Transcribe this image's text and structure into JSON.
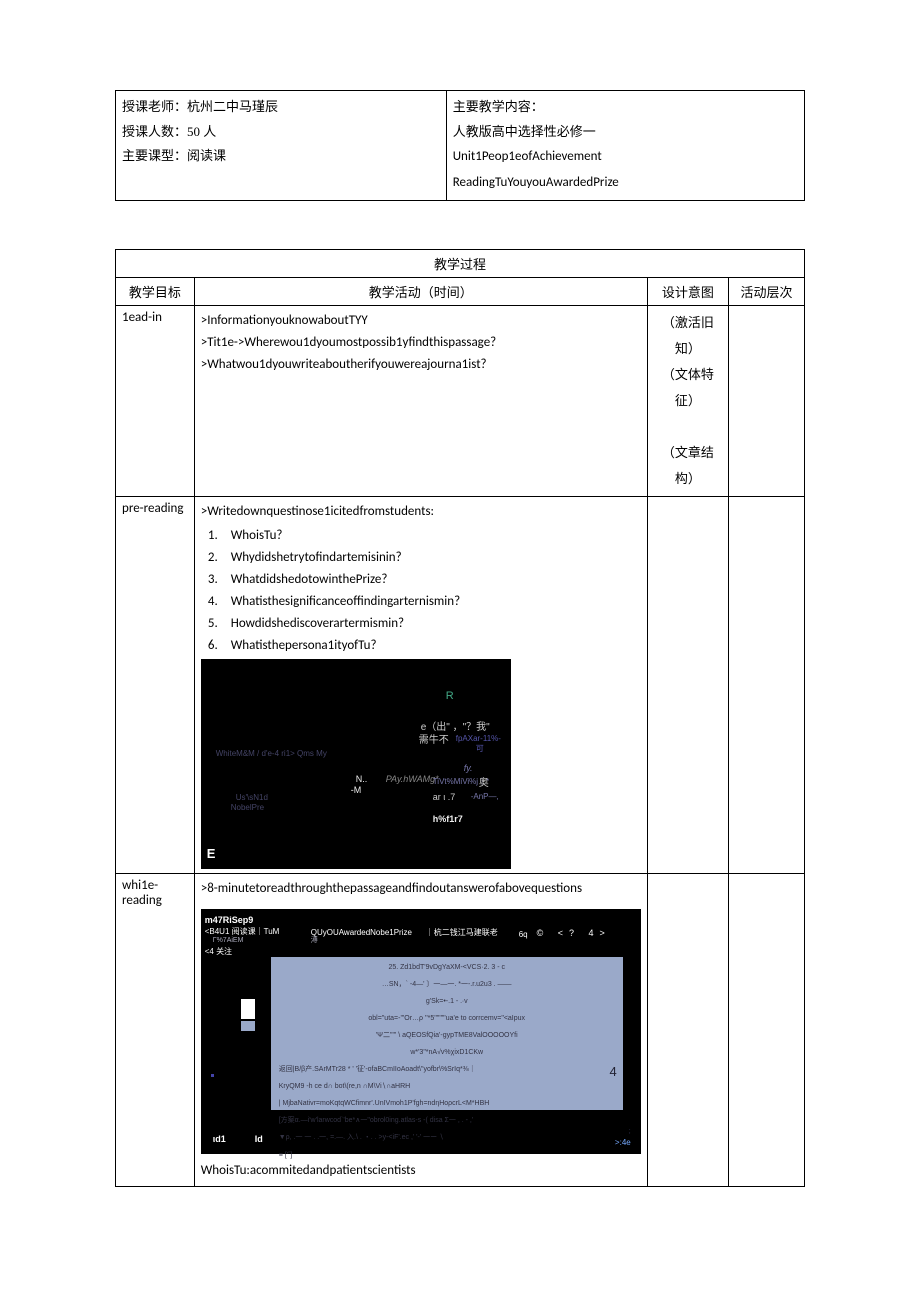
{
  "header": {
    "teacher_label": "授课老师：",
    "teacher_value": "杭州二中马瑾辰",
    "count_label": "授课人数：",
    "count_value": "50 人",
    "type_label": "主要课型：",
    "type_value": "阅读课",
    "content_label": "主要教学内容：",
    "content_line1": "人教版高中选择性必修一",
    "content_line2": "Unit1Peop1eofAchievement",
    "content_line3": "ReadingTuYouyouAwardedPrize"
  },
  "main": {
    "title": "教学过程",
    "cols": {
      "c1": "教学目标",
      "c2": "教学活动（时间）",
      "c3": "设计意图",
      "c4": "活动层次"
    },
    "rows": [
      {
        "stage": "1ead-in",
        "activity": {
          "l1": ">InformationyouknowaboutTYY",
          "l2": ">Tit1e->Wherewou1dyoumostpossib1yfindthispassage?",
          "l3": ">Whatwou1dyouwriteaboutherifyouwereajourna1ist?"
        },
        "design": {
          "d1": "（激活旧知）",
          "d2": "（文体特征）",
          "d3": "（文章结构）"
        }
      },
      {
        "stage": "pre-reading",
        "activity": {
          "intro": ">Writedownquestinose1icitedfromstudents:",
          "q": [
            "WhoisTu?",
            "Whydidshetrytofindartemisinin?",
            "WhatdidshedotowinthePrize?",
            "Whatisthesignificanceoffindingarternismin?",
            "Howdidshediscoverartermismin?",
            "Whatisthepersona1ityofTu?"
          ]
        },
        "img": {
          "r": "R",
          "chu": "e（出\" ，\"？我\"",
          "xu": "需牛不",
          "fp": "fpAXar-11%-",
          "ke": "可",
          "blue1": "WhiteM&M / d'e-4 ri1> Qms My",
          "n": "N..",
          "m": "-M",
          "pay": "PAy.hWAMg*",
          "fy": "fy.",
          "tw": "TiVt%MiVi%j｜*",
          "ao": "奥",
          "ar": "ar ι .7",
          "anp": "-AnP—,",
          "us": "Us'\\sN1d",
          "np": "NobelPre",
          "hf": "h%f1r7",
          "e": "E"
        }
      },
      {
        "stage": "whi1e-reading",
        "activity": {
          "l1": ">8-minutetoreadthroughthepassageandfindoutanswerofabovequestions",
          "tail": "WhoisTu:acommitedandpatientscientists"
        },
        "img": {
          "top1": "m47RiSep9",
          "top2": "<B4U1 阅读课｜TuM",
          "top3": "Γ%7AiEM",
          "top4": "<4 关注",
          "qy": "QUyOUAwardedNobe1Prize",
          "hz": "｜杭二钱江马建联老",
          "hang": "溥",
          "six": "6q",
          "ico": "©   <?    4>",
          "p1": "25.  Zd1bdT'9vDgYaXM-<VCS·2.   3 - c",
          "p2": "…SN，`  -4—' 〕一—一.  *一-.r.u2u3   . ——",
          "p3": "g'Sk=•-.1 - .∙v",
          "p4": "obl=\"uta=-'\"Or…ρ ''*5'\"\"'\"'ua'e to corrcemv=\"<aIpux",
          "p5": "'Ψ二'\"\"      \\ aQEOSfQia'-gypTME8ValOOOOOYfi",
          "p6": "w*'3\"*nA√v%χixD1CKw",
          "p7": "返回|B/β产.SArMTr28 *  '   '征'-ofaBCmIIoAoadt\\\"yofbr\\%SrIq*⅜｜",
          "p8": "KryQM9                    -h ce d∩ bot\\(re,n ∩M\\Vi∖∩aHRH",
          "p9": "| MjbaNativr=moKqtqWCfimnr'.UnIVmoh1P'fgh=ndηHoρcrL<M*HBH",
          "p10": "[方案α.—i'w'larwcod`'be*∧一\"obrol0ing.atlas-s -( disa Σ一 , . - ,'",
          "p11": "▼ρ,    .一  一 . .一,  =.—. 入.\\ . ・. .     >y-<iF'.ec   ,' '-' 一ー  ∖",
          "p12": "≡ ['ˆ]",
          "pnum": "4",
          "bl": "ιd1",
          "bl2": "Id",
          "br2": ";",
          "br": ">:4e"
        }
      }
    ]
  }
}
